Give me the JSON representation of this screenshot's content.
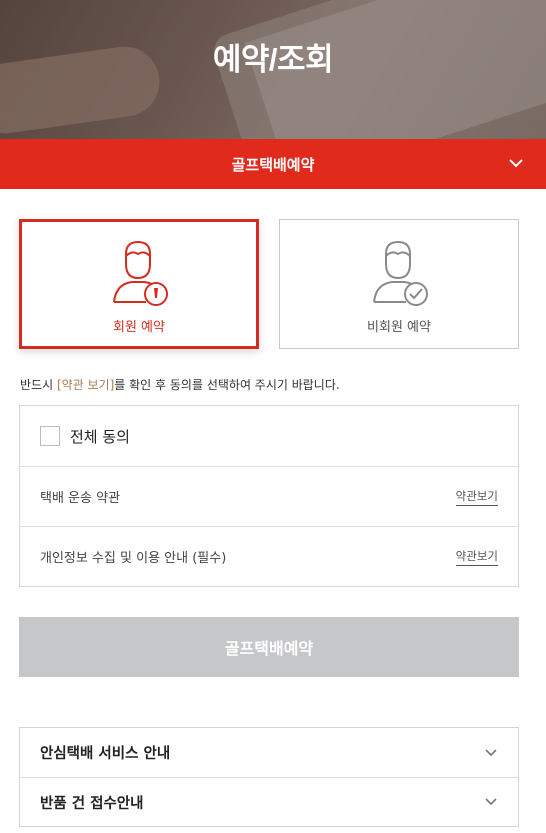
{
  "hero": {
    "title": "예약/조회"
  },
  "service_bar": {
    "label": "골프택배예약",
    "chevron_icon": "chevron-down-icon"
  },
  "reservation_types": [
    {
      "label": "회원 예약",
      "icon": "member-icon",
      "active": true
    },
    {
      "label": "비회원 예약",
      "icon": "non-member-icon",
      "active": false
    }
  ],
  "notice": {
    "before": "반드시 ",
    "highlight": "[약관 보기]",
    "after": "를 확인 후 동의를 선택하여 주시기 바랍니다."
  },
  "terms": {
    "agree_all_label": "전체 동의",
    "items": [
      {
        "label": "택배 운송 약관",
        "link": "약관보기"
      },
      {
        "label": "개인정보 수집 및 이용 안내 (필수)",
        "link": "약관보기"
      }
    ]
  },
  "submit": {
    "label": "골프택배예약"
  },
  "accordion": [
    {
      "label": "안심택배 서비스 안내"
    },
    {
      "label": "반품 건 접수안내"
    }
  ],
  "colors": {
    "accent": "#e02a1c",
    "active_border": "#d32d20",
    "disabled_button": "#c6c7c9",
    "notice_highlight": "#a97d50"
  }
}
